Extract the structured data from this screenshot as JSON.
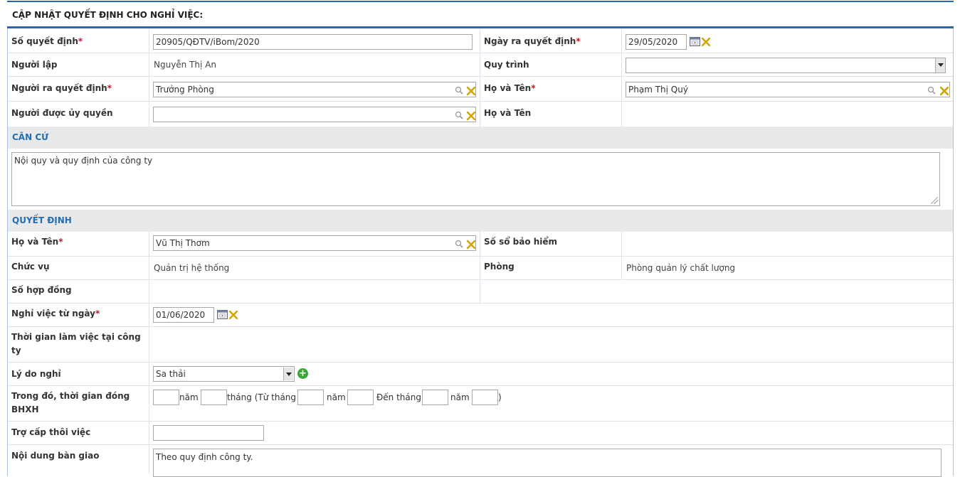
{
  "page_title": "CẬP NHẬT QUYẾT ĐỊNH CHO NGHỈ VIỆC:",
  "colors": {
    "accent": "#2a66b0",
    "section_text": "#1f6fb2",
    "required": "#c8102e",
    "add_icon": "#3aa63a"
  },
  "header": {
    "so_quyet_dinh": {
      "label": "Số quyết định",
      "required": "*",
      "value": "20905/QĐTV/iBom/2020"
    },
    "ngay_ra_quyet_dinh": {
      "label": "Ngày ra quyết định",
      "required": "*",
      "value": "29/05/2020"
    },
    "nguoi_lap": {
      "label": "Người lập",
      "value": "Nguyễn Thị An"
    },
    "quy_trinh": {
      "label": "Quy trình",
      "value": ""
    },
    "nguoi_ra_quyet_dinh": {
      "label": "Người ra quyết định",
      "required": "*",
      "value": "Trưởng Phòng"
    },
    "ho_va_ten_1": {
      "label": "Họ và Tên",
      "required": "*",
      "value": "Phạm Thị Quý"
    },
    "nguoi_duoc_uy_quyen": {
      "label": "Người được ủy quyền",
      "value": ""
    },
    "ho_va_ten_2": {
      "label": "Họ và Tên",
      "value": ""
    }
  },
  "can_cu": {
    "title": "CĂN CỨ",
    "text": "Nội quy và quy định của công ty"
  },
  "quyet_dinh": {
    "title": "QUYẾT ĐỊNH",
    "ho_va_ten": {
      "label": "Họ và Tên",
      "required": "*",
      "value": "Vũ Thị Thơm"
    },
    "so_so_bao_hiem": {
      "label": "Số sổ bảo hiểm",
      "value": ""
    },
    "chuc_vu": {
      "label": "Chức vụ",
      "value": "Quản trị hệ thống"
    },
    "phong": {
      "label": "Phòng",
      "value": "Phòng quản lý chất lượng"
    },
    "so_hop_dong": {
      "label": "Số hợp đồng",
      "value": ""
    },
    "nghi_viec_tu_ngay": {
      "label": "Nghỉ việc từ ngày",
      "required": "*",
      "value": "01/06/2020"
    },
    "thoi_gian_lam_viec": {
      "label_line1": "Thời gian làm việc tại công",
      "label_line2": "ty"
    },
    "ly_do_nghi": {
      "label": "Lý do nghỉ",
      "value": "Sa thải",
      "add_icon": "plus-circle-icon"
    },
    "bhxh": {
      "label_line1": "Trong đó, thời gian đóng",
      "label_line2": "BHXH",
      "t_nam": "năm",
      "t_thang": "tháng (Từ tháng",
      "t_nam2": "năm",
      "t_den_thang": "Đến tháng",
      "t_nam3": "năm",
      "t_close": ")"
    },
    "tro_cap": {
      "label": "Trợ cấp thôi việc",
      "value": ""
    },
    "noi_dung_ban_giao": {
      "label": "Nội dung bàn giao",
      "value": "Theo quy định công ty."
    }
  }
}
